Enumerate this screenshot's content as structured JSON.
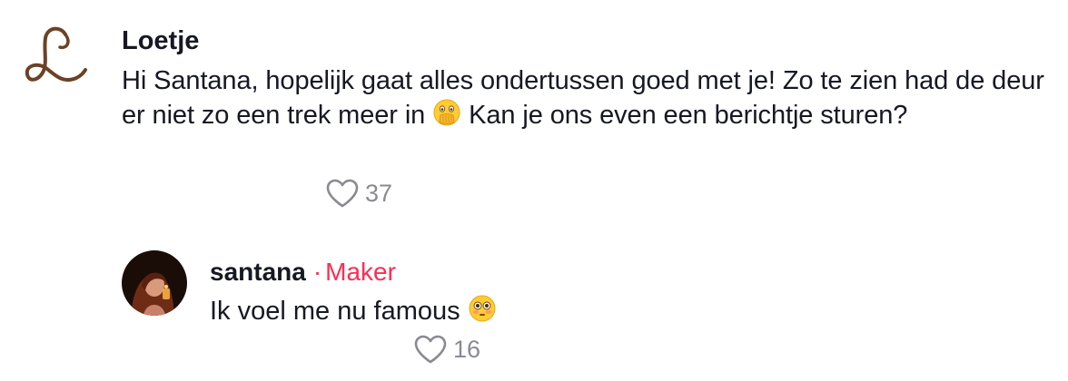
{
  "comment": {
    "username": "Loetje",
    "text_part1": "Hi Santana, hopelijk gaat alles ondertussen goed met je! Zo te zien had de deur er niet zo een trek meer in ",
    "emoji1": "face-with-open-eyes-and-hand-over-mouth",
    "text_part2": " Kan je ons even een berichtje sturen?",
    "like_count": "37",
    "avatar": "script-letter-L-logo"
  },
  "reply": {
    "username": "santana",
    "separator": "·",
    "badge": "Maker",
    "text": "Ik voel me nu famous ",
    "emoji": "flushed-face",
    "like_count": "16",
    "avatar": "profile-photo"
  },
  "colors": {
    "text": "#161823",
    "muted": "#8a8b91",
    "accent": "#fe2c55",
    "logo": "#6b4226"
  }
}
